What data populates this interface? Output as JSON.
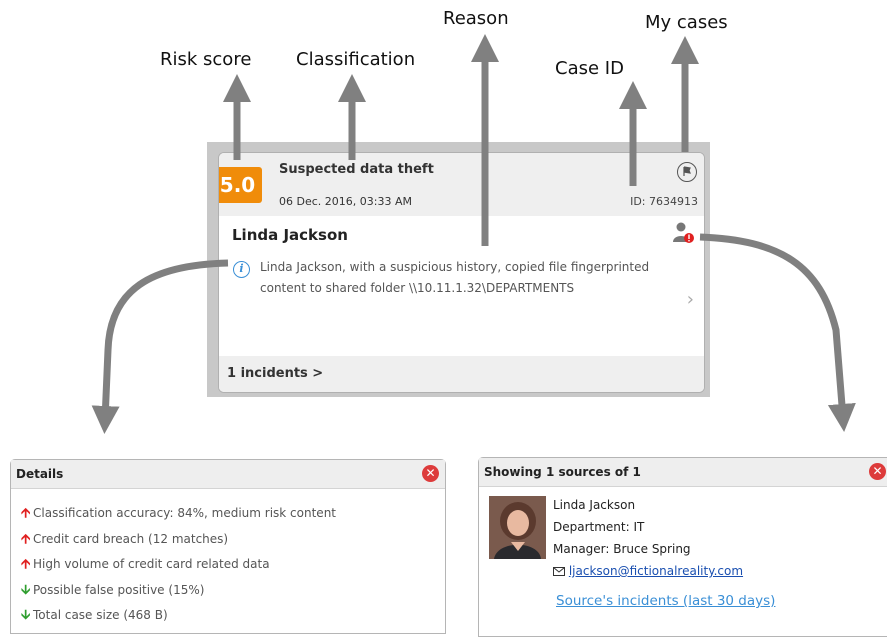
{
  "callouts": {
    "risk_score": "Risk score",
    "classification": "Classification",
    "reason": "Reason",
    "case_id": "Case ID",
    "my_cases": "My cases"
  },
  "card": {
    "score": "5.0",
    "classification": "Suspected data theft",
    "datetime": "06 Dec. 2016, 03:33 AM",
    "case_id": "ID: 7634913",
    "person": "Linda Jackson",
    "reason": "Linda Jackson, with a suspicious history, copied file fingerprinted content to shared folder \\\\10.11.1.32\\DEPARTMENTS",
    "incidents": "1 incidents >",
    "colors": {
      "score_badge": "#f08c0a",
      "info": "#3a8fd6"
    }
  },
  "details": {
    "title": "Details",
    "rows": [
      {
        "dir": "up",
        "text": "Classification accuracy: 84%, medium risk content"
      },
      {
        "dir": "up",
        "text": "Credit card breach (12 matches)"
      },
      {
        "dir": "up",
        "text": "High volume of credit card related data"
      },
      {
        "dir": "down",
        "text": "Possible false positive (15%)"
      },
      {
        "dir": "down",
        "text": "Total case size (468 B)"
      }
    ]
  },
  "sources": {
    "title": "Showing 1 sources of 1",
    "name": "Linda Jackson",
    "department": "Department: IT",
    "manager": "Manager: Bruce Spring",
    "email": "ljackson@fictionalreality.com",
    "incidents_link": "Source's incidents (last 30 days)"
  },
  "icons": {
    "flag": "flag-icon",
    "user_alert": "user-alert-icon",
    "info": "info-icon",
    "close": "close-icon",
    "mail": "mail-icon",
    "chevron": "chevron-right-icon"
  }
}
